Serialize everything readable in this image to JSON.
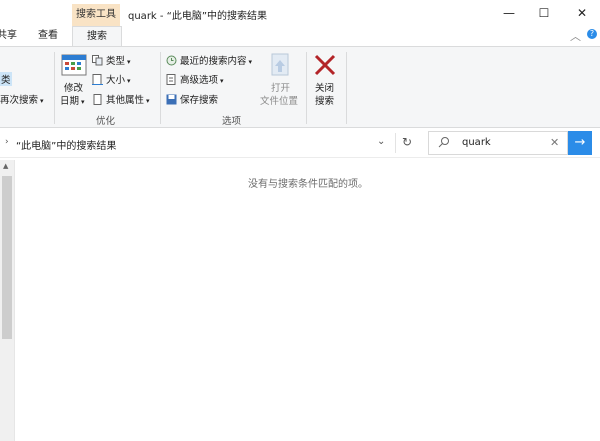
{
  "titlebar": {
    "tool_tab": "搜索工具",
    "title": "quark - “此电脑”中的搜索结果",
    "minimize": "—",
    "maximize": "☐",
    "close": "✕"
  },
  "tabs": [
    {
      "label": "共享"
    },
    {
      "label": "查看"
    },
    {
      "label": "搜索"
    }
  ],
  "ribbon": {
    "left_partial": {
      "type_label": "类",
      "search_again_label": "再次搜索"
    },
    "optimize": {
      "group_label": "优化",
      "modify_date_label": "修改",
      "modify_date_label2": "日期",
      "kind_label": "类型",
      "size_label": "大小",
      "other_props_label": "其他属性"
    },
    "options": {
      "group_label": "选项",
      "recent_label": "最近的搜索内容",
      "advanced_label": "高级选项",
      "save_label": "保存搜索",
      "open_location_label1": "打开",
      "open_location_label2": "文件位置"
    },
    "close_search": {
      "label1": "关闭",
      "label2": "搜索"
    }
  },
  "address": {
    "path": "“此电脑”中的搜索结果",
    "refresh_icon": "refresh-icon"
  },
  "search": {
    "value": "quark",
    "clear": "✕",
    "go": "→"
  },
  "content": {
    "empty_message": "没有与搜索条件匹配的项。"
  },
  "colors": {
    "tool_tab_bg": "#f9e3c5",
    "accent": "#2b8ce8",
    "close_x": "#b32428"
  }
}
